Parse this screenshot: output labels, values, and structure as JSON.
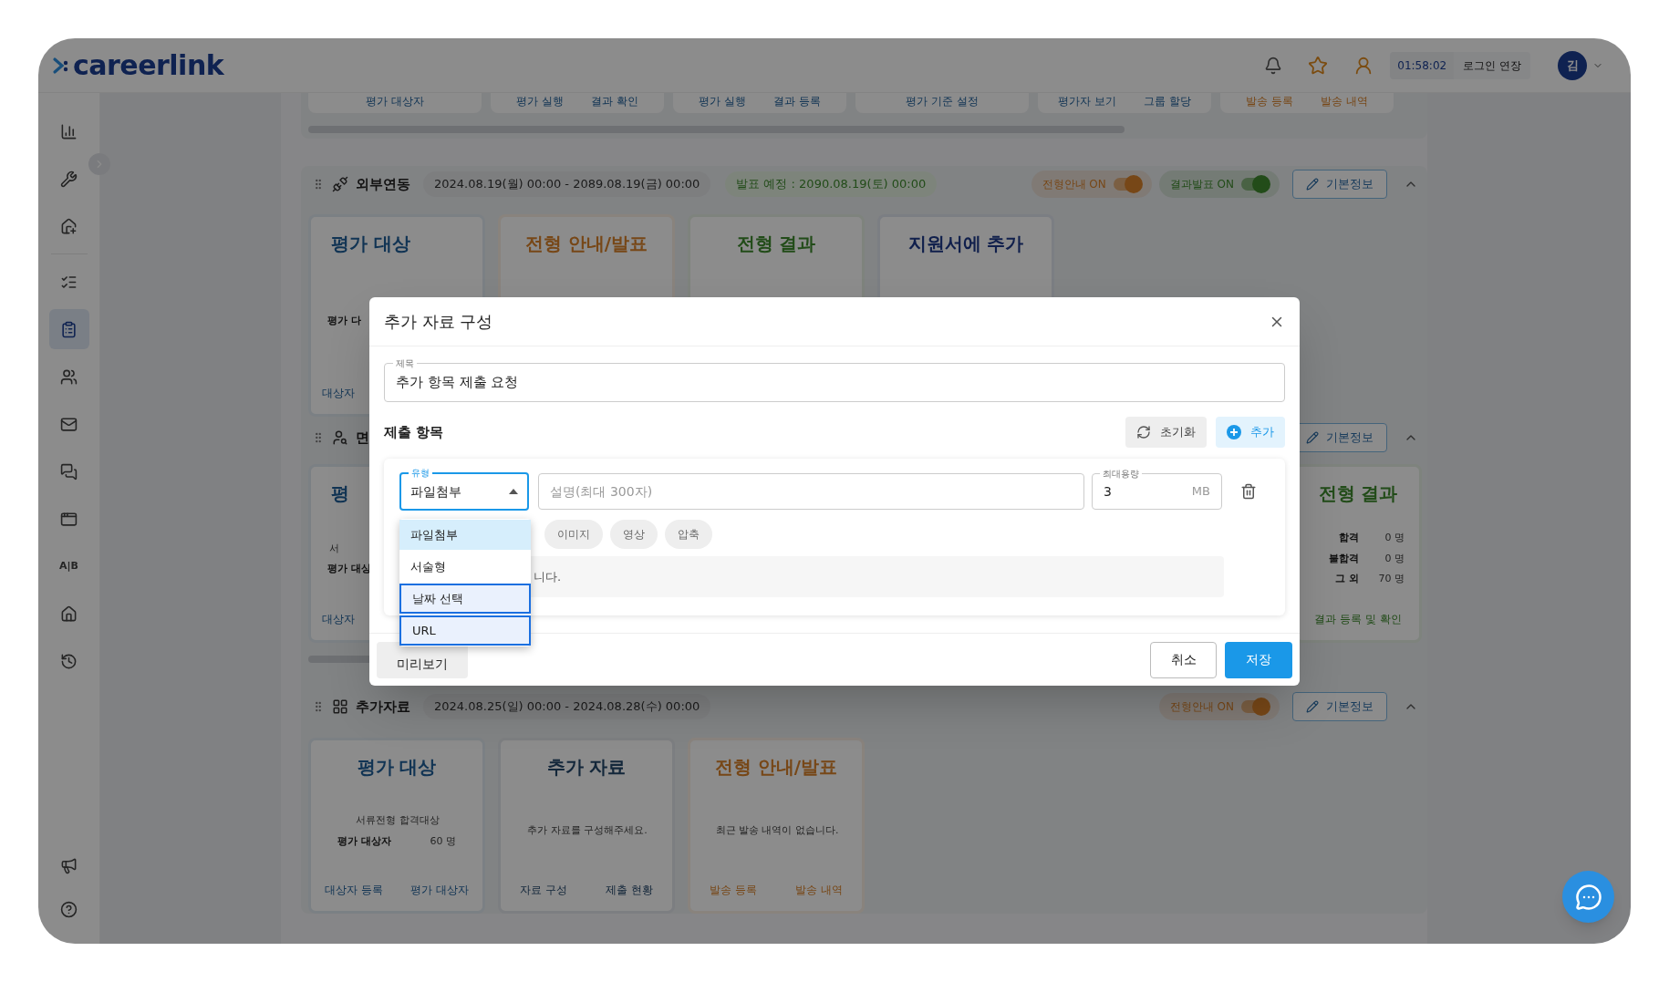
{
  "header": {
    "logo": "careerlink",
    "timer": "01:58:02",
    "extend_button": "로그인 연장",
    "avatar": "김"
  },
  "sidebar": {
    "items": [
      {
        "selected": false
      },
      {
        "selected": false
      },
      {
        "selected": false
      },
      {
        "selected": false
      },
      {
        "selected": true
      },
      {
        "selected": false
      },
      {
        "selected": false
      },
      {
        "selected": false
      },
      {
        "selected": false
      },
      {
        "label": "A|B",
        "selected": false
      },
      {
        "selected": false
      },
      {
        "selected": false
      }
    ],
    "bottom_items": [
      {
        "selected": false
      },
      {
        "selected": false
      }
    ]
  },
  "top_strip": {
    "cards": [
      {
        "kind": "target",
        "links": [
          "평가 대상자"
        ]
      },
      {
        "kind": "target",
        "links": [
          "평가 실행",
          "결과 확인"
        ]
      },
      {
        "kind": "target",
        "links": [
          "평가 실행",
          "결과 등록"
        ]
      },
      {
        "kind": "target",
        "links": [
          "평가 기준 설정"
        ]
      },
      {
        "kind": "target",
        "links": [
          "평가자 보기",
          "그룹 할당"
        ]
      },
      {
        "kind": "notice",
        "links": [
          "발송 등록",
          "발송 내역"
        ]
      }
    ]
  },
  "sections": [
    {
      "title": "외부연동",
      "period": "2024.08.19(월) 00:00 - 2089.08.19(금) 00:00",
      "announce": "발표 예정 : 2090.08.19(토) 00:00",
      "toggles": [
        {
          "label": "전형안내 ON",
          "on": true,
          "kind": "notice"
        },
        {
          "label": "결과발표 ON",
          "on": true,
          "kind": "result"
        }
      ],
      "edit_button": "기본정보",
      "expanded": true,
      "cards": [
        {
          "title": "평가 대상",
          "kind": "target",
          "rows": [
            {
              "label": "평가 다"
            }
          ],
          "links": [
            "대상자"
          ],
          "partly_hidden": true
        },
        {
          "title": "전형 안내/발표",
          "kind": "notice"
        },
        {
          "title": "전형 결과",
          "kind": "result"
        },
        {
          "title": "지원서에 추가",
          "kind": "form"
        }
      ]
    },
    {
      "title": "면",
      "edit_button": "기본정보",
      "expanded": true,
      "cards_spread": true,
      "scrollbar": true,
      "cards": [
        {
          "title": "평",
          "kind": "target",
          "text": "서",
          "rows": [
            {
              "label": "평가 대상"
            }
          ],
          "links": [
            "대상자"
          ],
          "partly_hidden": true
        },
        {
          "title": "전형 결과",
          "kind": "result",
          "rows": [
            {
              "label": "합격",
              "value": "0 명"
            },
            {
              "label": "불합격",
              "value": "0 명"
            },
            {
              "label": "그 외",
              "value": "70 명"
            }
          ],
          "links": [
            "결과 등록 및 확인"
          ]
        }
      ]
    },
    {
      "title": "추가자료",
      "period": "2024.08.25(일) 00:00 - 2024.08.28(수) 00:00",
      "toggles": [
        {
          "label": "전형안내 ON",
          "on": true,
          "kind": "notice"
        }
      ],
      "edit_button": "기본정보",
      "expanded": true,
      "cards": [
        {
          "title": "평가 대상",
          "kind": "target",
          "text": "서류전형 합격대상",
          "rows": [
            {
              "label": "평가 대상자",
              "value": "60 명"
            }
          ],
          "links": [
            "대상자 등록",
            "평가 대상자"
          ]
        },
        {
          "title": "추가 자료",
          "kind": "material",
          "text": "추가 자료를 구성해주세요.",
          "links": [
            "자료 구성",
            "제출 현황"
          ]
        },
        {
          "title": "전형 안내/발표",
          "kind": "notice",
          "text": "최근 발송 내역이 없습니다.",
          "links": [
            "발송 등록",
            "발송 내역"
          ]
        }
      ]
    }
  ],
  "modal": {
    "title": "추가 자료 구성",
    "title_field": {
      "label": "제목",
      "value": "추가 항목 제출 요청"
    },
    "items_heading": "제출 항목",
    "reset_button": "초기화",
    "add_button": "추가",
    "item": {
      "type_field": {
        "label": "유형",
        "value": "파일첨부",
        "open": true
      },
      "description_field": {
        "placeholder": "설명(최대 300자)"
      },
      "size_field": {
        "label": "최대용량",
        "value": "3",
        "unit": "MB"
      },
      "chips": [
        "이미지",
        "영상",
        "압축"
      ],
      "notice": "니다."
    },
    "dropdown": {
      "options": [
        {
          "label": "파일첨부",
          "selected": true,
          "outlined": false
        },
        {
          "label": "서술형",
          "selected": false,
          "outlined": false
        },
        {
          "label": "날짜 선택",
          "selected": false,
          "outlined": true
        },
        {
          "label": "URL",
          "selected": false,
          "outlined": true
        }
      ]
    },
    "preview_button": "미리보기",
    "cancel_button": "취소",
    "save_button": "저장"
  }
}
